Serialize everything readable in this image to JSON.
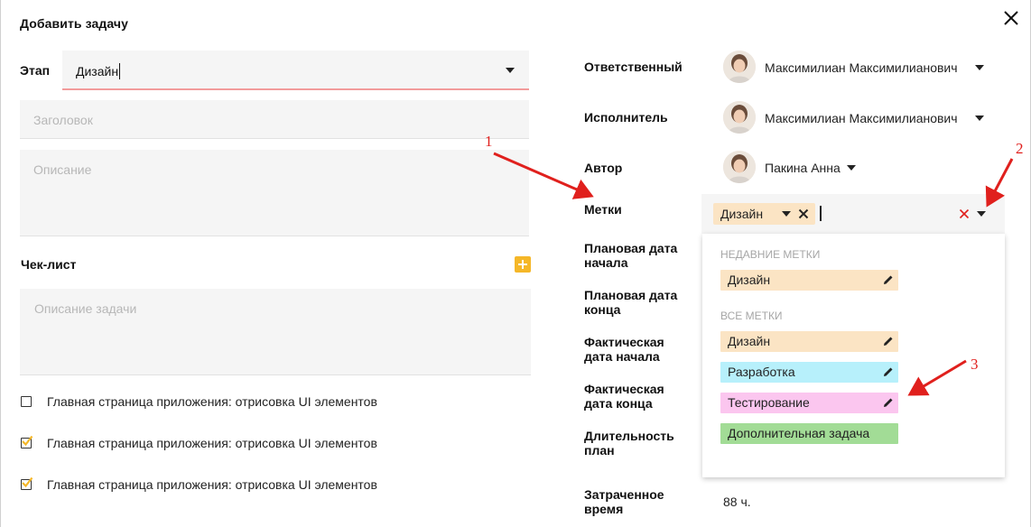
{
  "dialog": {
    "title": "Добавить  задачу"
  },
  "left": {
    "stage_label": "Этап",
    "stage_value": "Дизайн",
    "title_placeholder": "Заголовок",
    "description_placeholder": "Описание",
    "checklist_label": "Чек-лист",
    "checklist_input_placeholder": "Описание задачи",
    "checklist_items": [
      {
        "text": "Главная страница приложения: отрисовка UI элементов",
        "checked": false
      },
      {
        "text": "Главная страница приложения: отрисовка UI элементов",
        "checked": true
      },
      {
        "text": "Главная страница приложения: отрисовка UI элементов",
        "checked": true
      }
    ]
  },
  "right": {
    "responsible_label": "Ответственный",
    "responsible_name": "Максимилиан Максимилианович",
    "executor_label": "Исполнитель",
    "executor_name": "Максимилиан Максимилианович",
    "author_label": "Автор",
    "author_name": "Пакина Анна",
    "tags_label": "Метки",
    "selected_tag": "Дизайн",
    "plan_start_label": "Плановая дата начала",
    "plan_start_line1": "Плановая дата",
    "plan_start_line2": "начала",
    "plan_end_line1": "Плановая дата",
    "plan_end_line2": "конца",
    "fact_start_line1": "Фактическая",
    "fact_start_line2": "дата начала",
    "fact_end_line1": "Фактическая",
    "fact_end_line2": "дата конца",
    "duration_line1": "Длительность",
    "duration_line2": "план",
    "spent_line1": "Затраченное",
    "spent_line2": "время",
    "spent_value": "88 ч."
  },
  "tags_dropdown": {
    "recent_title": "НЕДАВНИЕ МЕТКИ",
    "recent": [
      {
        "label": "Дизайн",
        "color": "#fbe4c4"
      }
    ],
    "all_title": "ВСЕ МЕТКИ",
    "all": [
      {
        "label": "Дизайн",
        "color": "#fbe4c4"
      },
      {
        "label": "Разработка",
        "color": "#b7f0fb"
      },
      {
        "label": "Тестирование",
        "color": "#fbc6ef"
      },
      {
        "label": "Дополнительная задача",
        "color": "#a2dc96"
      }
    ]
  },
  "annotations": {
    "n1": "1",
    "n2": "2",
    "n3": "3",
    "arrow_color": "#e0201d"
  },
  "colors": {
    "accent": "#f5b728",
    "error_underline": "#f29b9b",
    "clear_x": "#e0201d"
  }
}
